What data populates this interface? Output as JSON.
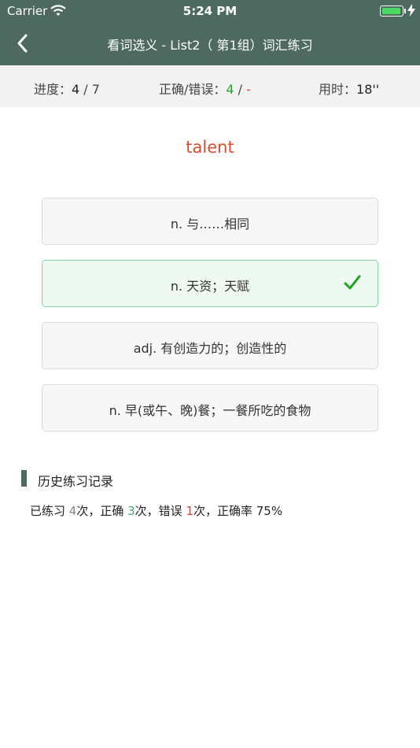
{
  "status_bar": {
    "carrier": "Carrier",
    "time": "5:24 PM",
    "battery_level": 1.0
  },
  "nav": {
    "title": "看词选义 - List2（ 第1组）词汇练习"
  },
  "stats": {
    "progress_label": "进度：",
    "progress_current": "4",
    "progress_sep": " / ",
    "progress_total": "7",
    "accuracy_label": "正确/错误：",
    "correct_count": "4",
    "accuracy_sep": " / ",
    "wrong_count": "-",
    "time_label": "用时：",
    "time_value": "18''"
  },
  "question": {
    "word": "talent"
  },
  "options": [
    {
      "text": "n. 与……相同",
      "state": "normal"
    },
    {
      "text": "n. 天资；天赋",
      "state": "correct"
    },
    {
      "text": "adj. 有创造力的；创造性的",
      "state": "normal"
    },
    {
      "text": "n. 早(或午、晚)餐；一餐所吃的食物",
      "state": "normal"
    }
  ],
  "history": {
    "title": "历史练习记录",
    "p1": "已练习 ",
    "practice_count": "4",
    "p2": "次，正确 ",
    "correct_count": "3",
    "p3": "次，错误 ",
    "wrong_count": "1",
    "p4": "次，正确率 ",
    "rate": "75%"
  },
  "colors": {
    "header_bg": "#4e6a60",
    "word": "#e04a2f",
    "correct": "#2e9e2e",
    "wrong": "#e53935",
    "correct_option_bg": "#eefaf1",
    "correct_option_border": "#7fd39a"
  },
  "icons": {
    "back": "chevron-left-icon",
    "check": "checkmark-icon",
    "wifi": "wifi-icon",
    "battery": "battery-icon",
    "charge": "charging-bolt-icon"
  }
}
